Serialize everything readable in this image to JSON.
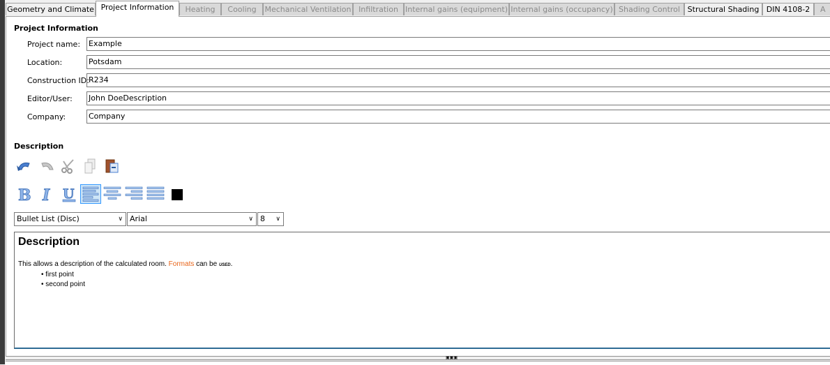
{
  "tabs": [
    {
      "label": "Geometry and Climate",
      "enabled": true
    },
    {
      "label": "Project Information",
      "enabled": true,
      "active": true
    },
    {
      "label": "Heating",
      "enabled": false
    },
    {
      "label": "Cooling",
      "enabled": false
    },
    {
      "label": "Mechanical Ventilation",
      "enabled": false
    },
    {
      "label": "Infiltration",
      "enabled": false
    },
    {
      "label": "Internal gains (equipment)",
      "enabled": false
    },
    {
      "label": "Internal gains (occupancy)",
      "enabled": false
    },
    {
      "label": "Shading Control",
      "enabled": false
    },
    {
      "label": "Structural Shading",
      "enabled": true
    },
    {
      "label": "DIN 4108-2",
      "enabled": true
    },
    {
      "label": "A",
      "enabled": false
    }
  ],
  "project": {
    "heading": "Project Information",
    "fields": [
      {
        "label": "Project name:",
        "value": "Example"
      },
      {
        "label": "Location:",
        "value": "Potsdam"
      },
      {
        "label": "Construction ID:",
        "value": "R234"
      },
      {
        "label": "Editor/User:",
        "value": "John DoeDescription"
      },
      {
        "label": "Company:",
        "value": "Company"
      }
    ]
  },
  "description": {
    "heading": "Description",
    "toolbar1": [
      "undo-icon",
      "redo-icon",
      "cut-icon",
      "copy-icon",
      "paste-icon"
    ],
    "toolbar2": [
      "bold-icon",
      "italic-icon",
      "underline-icon",
      "align-left-icon",
      "align-center-icon",
      "align-right-icon",
      "justify-icon",
      "text-color-icon"
    ],
    "text_color": "#000000",
    "list_style": "Bullet List (Disc)",
    "font": "Arial",
    "size": "8",
    "editor": {
      "title": "Description",
      "text_before": "This allows a description of the calculated room. ",
      "link": "Formats",
      "text_mid": " can be ",
      "styled": "used",
      "text_end": ".",
      "bullets": [
        "first point",
        "second point"
      ],
      "link_color": "#e8651a"
    }
  }
}
